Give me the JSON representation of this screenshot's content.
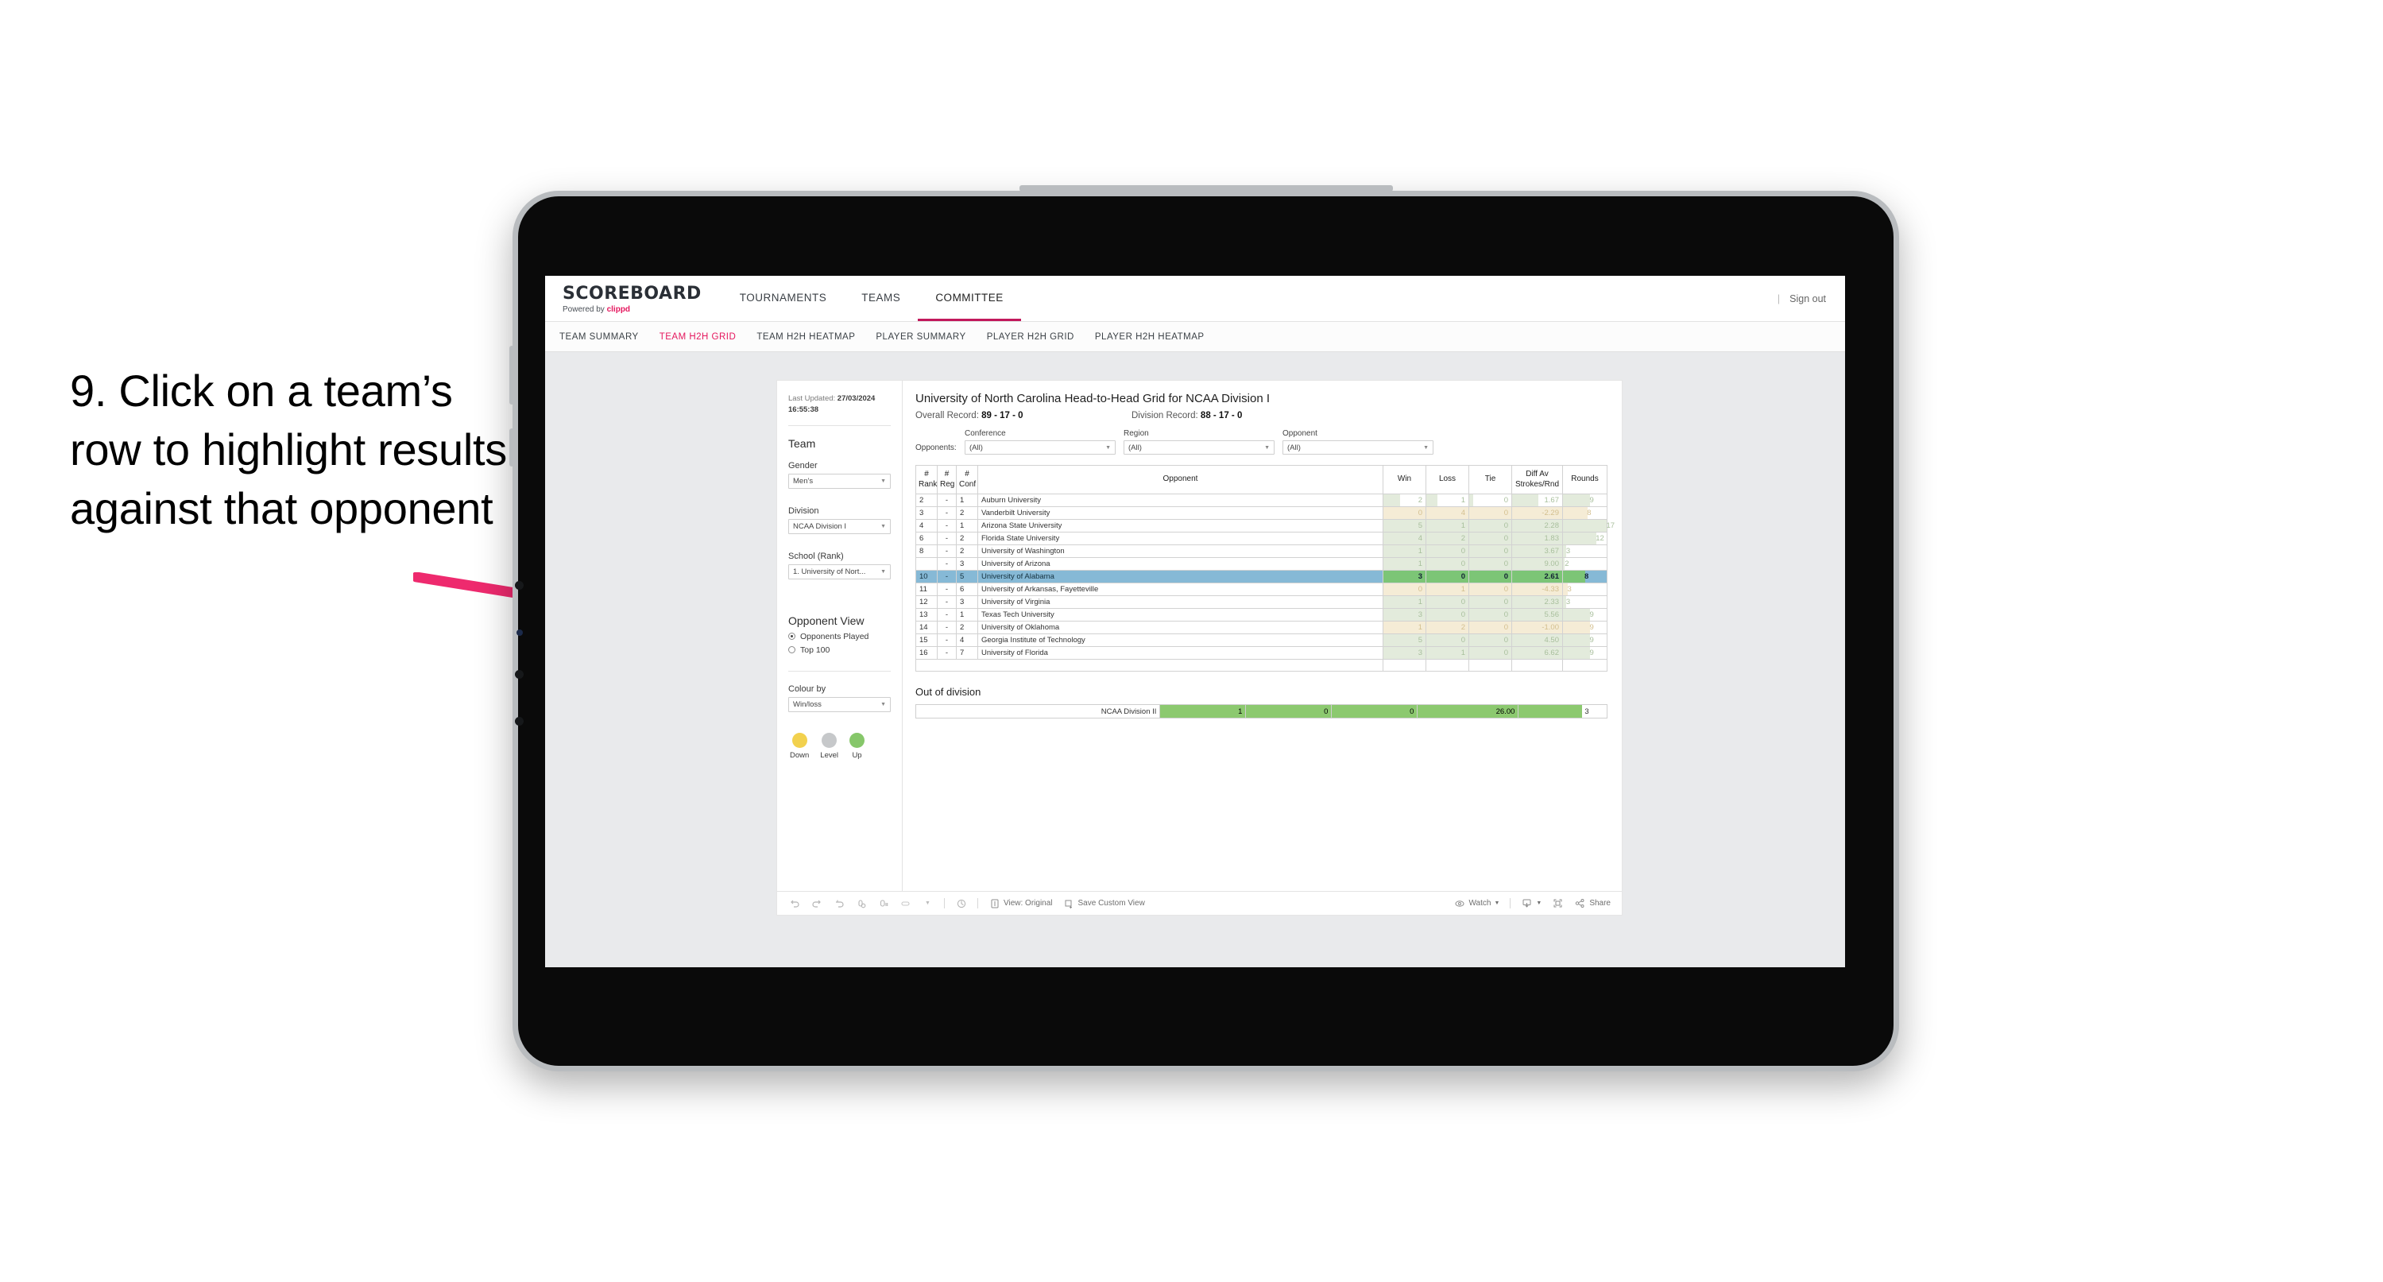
{
  "caption": {
    "text": "9. Click on a team’s row to highlight results against that opponent"
  },
  "topnav": {
    "brand_name": "SCOREBOARD",
    "brand_sub_prefix": "Powered by ",
    "brand_sub_mark": "clippd",
    "items": [
      {
        "label": "TOURNAMENTS",
        "active": false
      },
      {
        "label": "TEAMS",
        "active": false
      },
      {
        "label": "COMMITTEE",
        "active": true
      }
    ],
    "sign_out": "Sign out"
  },
  "subnav": {
    "items": [
      {
        "label": "TEAM SUMMARY",
        "active": false
      },
      {
        "label": "TEAM H2H GRID",
        "active": true
      },
      {
        "label": "TEAM H2H HEATMAP",
        "active": false
      },
      {
        "label": "PLAYER SUMMARY",
        "active": false
      },
      {
        "label": "PLAYER H2H GRID",
        "active": false
      },
      {
        "label": "PLAYER H2H HEATMAP",
        "active": false
      }
    ]
  },
  "sidebar": {
    "last_updated_label": "Last Updated: ",
    "last_updated_value": "27/03/2024 16:55:38",
    "team_heading": "Team",
    "gender_label": "Gender",
    "gender_value": "Men’s",
    "division_label": "Division",
    "division_value": "NCAA Division I",
    "school_label": "School (Rank)",
    "school_value": "1. University of Nort...",
    "opponent_view_heading": "Opponent View",
    "opponent_view_options": [
      {
        "label": "Opponents Played",
        "selected": true
      },
      {
        "label": "Top 100",
        "selected": false
      }
    ],
    "colour_by_label": "Colour by",
    "colour_by_value": "Win/loss",
    "legend": [
      {
        "label": "Down",
        "color": "#f2d14e"
      },
      {
        "label": "Level",
        "color": "#c6c8ca"
      },
      {
        "label": "Up",
        "color": "#86c76a"
      }
    ]
  },
  "viz": {
    "title": "University of North Carolina Head-to-Head Grid for NCAA Division I",
    "overall_record_label": "Overall Record: ",
    "overall_record_value": "89 - 17 - 0",
    "division_record_label": "Division Record: ",
    "division_record_value": "88 - 17 - 0",
    "opponents_lead": "Opponents:",
    "filters": [
      {
        "label": "Conference",
        "value": "(All)"
      },
      {
        "label": "Region",
        "value": "(All)"
      },
      {
        "label": "Opponent",
        "value": "(All)"
      }
    ],
    "out_of_division_title": "Out of division"
  },
  "chart_data": {
    "type": "table",
    "title": "University of North Carolina Head-to-Head Grid for NCAA Division I",
    "columns": [
      "# Rank",
      "# Reg",
      "# Conf",
      "Opponent",
      "Win",
      "Loss",
      "Tie",
      "Diff Av Strokes/Rnd",
      "Rounds"
    ],
    "rows": [
      {
        "rank": "2",
        "reg": "-",
        "conf": "1",
        "opponent": "Auburn University",
        "win": "2",
        "loss": "1",
        "tie": "0",
        "diff": "1.67",
        "rounds": "9",
        "tone": "up",
        "win_w": 40,
        "loss_w": 26,
        "tie_w": 10,
        "diff_w": 52,
        "rounds_w": 62,
        "highlight": false
      },
      {
        "rank": "3",
        "reg": "-",
        "conf": "2",
        "opponent": "Vanderbilt University",
        "win": "0",
        "loss": "4",
        "tie": "0",
        "diff": "-2.29",
        "rounds": "8",
        "tone": "down",
        "win_w": 100,
        "loss_w": 100,
        "tie_w": 100,
        "diff_w": 100,
        "rounds_w": 56,
        "highlight": false
      },
      {
        "rank": "4",
        "reg": "-",
        "conf": "1",
        "opponent": "Arizona State University",
        "win": "5",
        "loss": "1",
        "tie": "0",
        "diff": "2.28",
        "rounds": "17",
        "tone": "up",
        "win_w": 100,
        "loss_w": 100,
        "tie_w": 100,
        "diff_w": 100,
        "rounds_w": 100,
        "highlight": false
      },
      {
        "rank": "6",
        "reg": "-",
        "conf": "2",
        "opponent": "Florida State University",
        "win": "4",
        "loss": "2",
        "tie": "0",
        "diff": "1.83",
        "rounds": "12",
        "tone": "up",
        "win_w": 100,
        "loss_w": 100,
        "tie_w": 100,
        "diff_w": 100,
        "rounds_w": 76,
        "highlight": false
      },
      {
        "rank": "8",
        "reg": "-",
        "conf": "2",
        "opponent": "University of Washington",
        "win": "1",
        "loss": "0",
        "tie": "0",
        "diff": "3.67",
        "rounds": "3",
        "tone": "up",
        "win_w": 100,
        "loss_w": 100,
        "tie_w": 100,
        "diff_w": 100,
        "rounds_w": 8,
        "highlight": false
      },
      {
        "rank": "",
        "reg": "-",
        "conf": "3",
        "opponent": "University of Arizona",
        "win": "1",
        "loss": "0",
        "tie": "0",
        "diff": "9.00",
        "rounds": "2",
        "tone": "up",
        "win_w": 100,
        "loss_w": 100,
        "tie_w": 100,
        "diff_w": 100,
        "rounds_w": 4,
        "highlight": false
      },
      {
        "rank": "10",
        "reg": "-",
        "conf": "5",
        "opponent": "University of Alabama",
        "win": "3",
        "loss": "0",
        "tie": "0",
        "diff": "2.61",
        "rounds": "8",
        "tone": "up",
        "win_w": 100,
        "loss_w": 100,
        "tie_w": 100,
        "diff_w": 100,
        "rounds_w": 50,
        "highlight": true
      },
      {
        "rank": "11",
        "reg": "-",
        "conf": "6",
        "opponent": "University of Arkansas, Fayetteville",
        "win": "0",
        "loss": "1",
        "tie": "0",
        "diff": "-4.33",
        "rounds": "3",
        "tone": "down",
        "win_w": 100,
        "loss_w": 100,
        "tie_w": 100,
        "diff_w": 100,
        "rounds_w": 11,
        "highlight": false
      },
      {
        "rank": "12",
        "reg": "-",
        "conf": "3",
        "opponent": "University of Virginia",
        "win": "1",
        "loss": "0",
        "tie": "0",
        "diff": "2.33",
        "rounds": "3",
        "tone": "up",
        "win_w": 100,
        "loss_w": 100,
        "tie_w": 100,
        "diff_w": 100,
        "rounds_w": 8,
        "highlight": false
      },
      {
        "rank": "13",
        "reg": "-",
        "conf": "1",
        "opponent": "Texas Tech University",
        "win": "3",
        "loss": "0",
        "tie": "0",
        "diff": "5.56",
        "rounds": "9",
        "tone": "up",
        "win_w": 100,
        "loss_w": 100,
        "tie_w": 100,
        "diff_w": 100,
        "rounds_w": 62,
        "highlight": false
      },
      {
        "rank": "14",
        "reg": "-",
        "conf": "2",
        "opponent": "University of Oklahoma",
        "win": "1",
        "loss": "2",
        "tie": "0",
        "diff": "-1.00",
        "rounds": "9",
        "tone": "down",
        "win_w": 100,
        "loss_w": 100,
        "tie_w": 100,
        "diff_w": 100,
        "rounds_w": 62,
        "highlight": false
      },
      {
        "rank": "15",
        "reg": "-",
        "conf": "4",
        "opponent": "Georgia Institute of Technology",
        "win": "5",
        "loss": "0",
        "tie": "0",
        "diff": "4.50",
        "rounds": "9",
        "tone": "up",
        "win_w": 100,
        "loss_w": 100,
        "tie_w": 100,
        "diff_w": 100,
        "rounds_w": 62,
        "highlight": false
      },
      {
        "rank": "16",
        "reg": "-",
        "conf": "7",
        "opponent": "University of Florida",
        "win": "3",
        "loss": "1",
        "tie": "0",
        "diff": "6.62",
        "rounds": "9",
        "tone": "up",
        "win_w": 100,
        "loss_w": 100,
        "tie_w": 100,
        "diff_w": 100,
        "rounds_w": 62,
        "highlight": false
      }
    ],
    "out_of_division": {
      "label": "NCAA Division II",
      "win": "1",
      "loss": "0",
      "tie": "0",
      "diff": "26.00",
      "rounds": "3"
    },
    "colors": {
      "up": "#e3ebdc",
      "down": "#f5ecd6",
      "highlight_row": "#86b9d6",
      "highlight_bar": "#7cc576",
      "ood_bar": "#8cc96f"
    }
  },
  "toolbar": {
    "view_label": "View: Original",
    "save_label": "Save Custom View",
    "watch_label": "Watch",
    "share_label": "Share"
  }
}
